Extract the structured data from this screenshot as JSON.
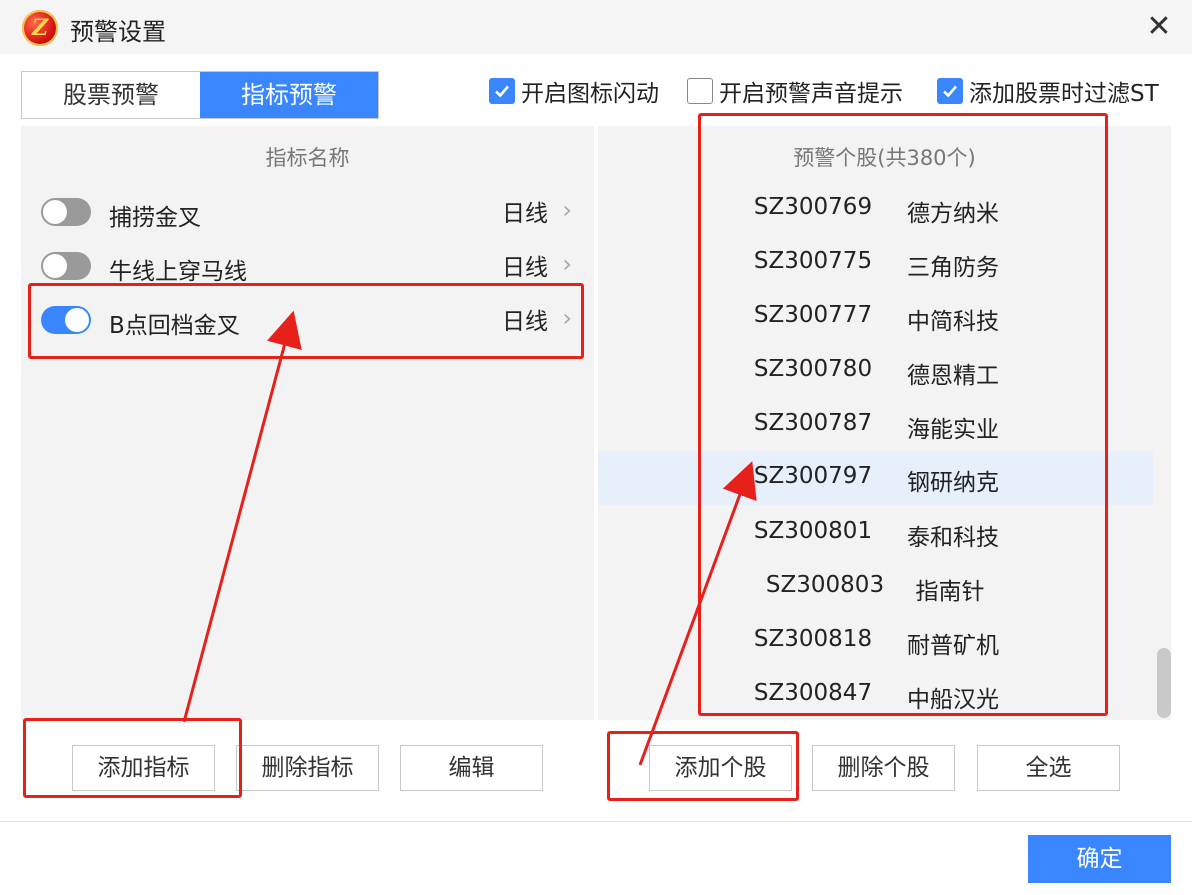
{
  "window": {
    "title": "预警设置",
    "logo_icon": "app-logo-icon",
    "close_label": "✕"
  },
  "tabs": [
    {
      "label": "股票预警",
      "active": false
    },
    {
      "label": "指标预警",
      "active": true
    }
  ],
  "options": [
    {
      "label": "开启图标闪动",
      "checked": true
    },
    {
      "label": "开启预警声音提示",
      "checked": false
    },
    {
      "label": "添加股票时过滤ST",
      "checked": true
    }
  ],
  "indicator_panel": {
    "header": "指标名称",
    "items": [
      {
        "name": "捕捞金叉",
        "period": "日线",
        "enabled": false
      },
      {
        "name": "牛线上穿马线",
        "period": "日线",
        "enabled": false
      },
      {
        "name": "B点回档金叉",
        "period": "日线",
        "enabled": true
      }
    ]
  },
  "stock_panel": {
    "header": "预警个股(共380个)",
    "items": [
      {
        "code": "SZ300769",
        "name": "德方纳米"
      },
      {
        "code": "SZ300775",
        "name": "三角防务"
      },
      {
        "code": "SZ300777",
        "name": "中简科技"
      },
      {
        "code": "SZ300780",
        "name": "德恩精工"
      },
      {
        "code": "SZ300787",
        "name": "海能实业"
      },
      {
        "code": "SZ300797",
        "name": "钢研纳克",
        "selected": true
      },
      {
        "code": "SZ300801",
        "name": "泰和科技"
      },
      {
        "code": "SZ300803",
        "name": "指南针"
      },
      {
        "code": "SZ300818",
        "name": "耐普矿机"
      },
      {
        "code": "SZ300847",
        "name": "中船汉光"
      }
    ]
  },
  "buttons": {
    "add_indicator": "添加指标",
    "delete_indicator": "删除指标",
    "edit": "编辑",
    "add_stock": "添加个股",
    "delete_stock": "删除个股",
    "select_all": "全选",
    "confirm": "确定"
  },
  "colors": {
    "accent": "#3a86ff",
    "annotation": "#e8201a"
  }
}
